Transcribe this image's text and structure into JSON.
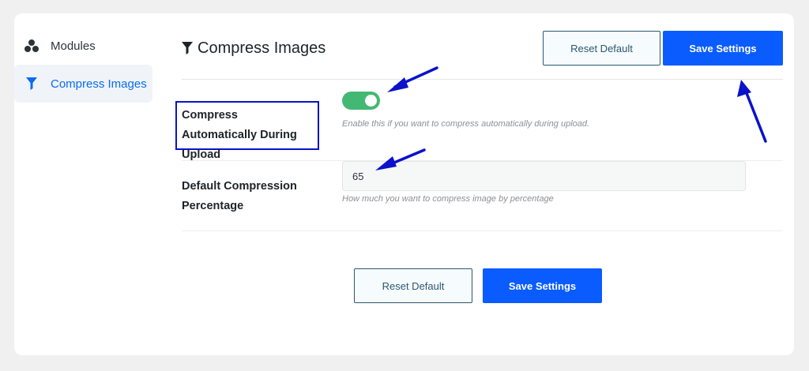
{
  "sidebar": {
    "items": [
      {
        "label": "Modules",
        "icon": "modules-icon",
        "active": false
      },
      {
        "label": "Compress Images",
        "icon": "filter-icon",
        "active": true
      }
    ]
  },
  "header": {
    "title": "Compress Images",
    "reset_label": "Reset Default",
    "save_label": "Save Settings"
  },
  "settings": {
    "auto_compress": {
      "label": "Compress Automatically During Upload",
      "enabled": true,
      "hint": "Enable this if you want to compress automatically during upload."
    },
    "percentage": {
      "label": "Default Compression Percentage",
      "value": "65",
      "hint": "How much you want to compress image by percentage"
    }
  },
  "footer": {
    "reset_label": "Reset Default",
    "save_label": "Save Settings"
  },
  "colors": {
    "accent": "#0a5cff",
    "toggle_on": "#43b873",
    "annotation": "#0b12c9"
  }
}
